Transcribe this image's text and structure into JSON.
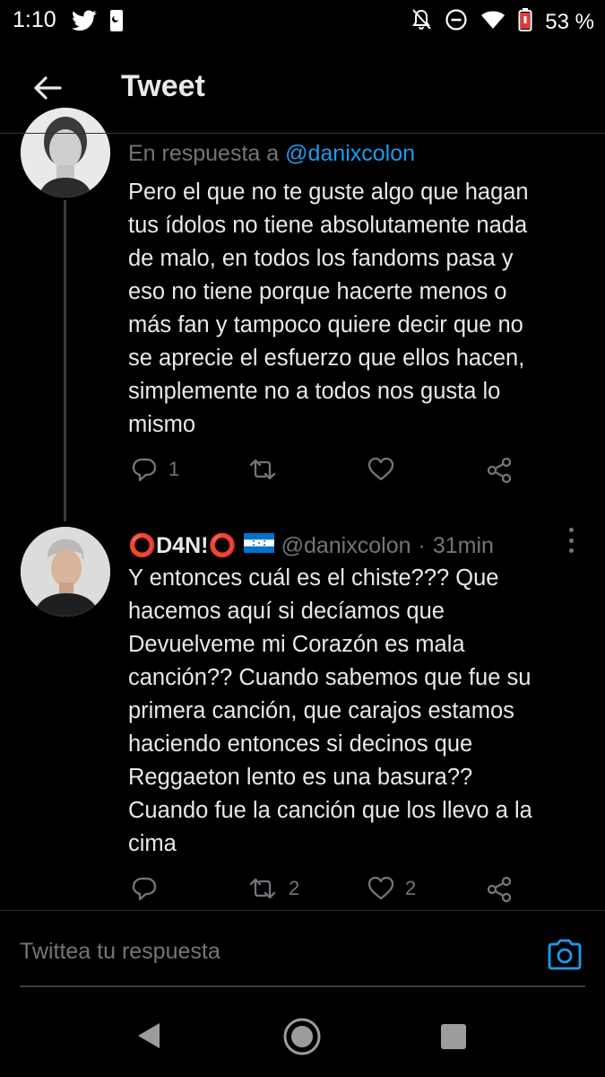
{
  "status_bar": {
    "time": "1:10",
    "battery": "53 %"
  },
  "header": {
    "title": "Tweet"
  },
  "tweet1": {
    "reply_prefix": "En respuesta a",
    "reply_handle": "@danixcolon",
    "text": "Pero el que no te guste algo que hagan\ntus ídolos no tiene absolutamente nada\nde malo, en todos los fandoms pasa y\neso no tiene porque hacerte menos o\nmás fan y tampoco quiere decir que no\nse aprecie el esfuerzo que ellos hacen,\nsimplemente no a todos nos gusta lo\nmismo",
    "reply_count": "1",
    "retweet_count": "",
    "like_count": ""
  },
  "tweet2": {
    "name": "⭕D4N!⭕",
    "handle": "@danixcolon",
    "separator": "·",
    "time": "31min",
    "text": "Y entonces cuál es el chiste??? Que\nhacemos aquí si decíamos que\nDevuelveme mi Corazón es mala\ncanción?? Cuando sabemos que fue su\nprimera canción, que carajos estamos\nhaciendo entonces si decinos que\nReggaeton lento es una basura??\nCuando fue la canción que los llevo a la\ncima",
    "reply_count": "",
    "retweet_count": "2",
    "like_count": "2"
  },
  "composer": {
    "placeholder": "Twittea tu respuesta"
  },
  "colors": {
    "background": "#000000",
    "text": "#e7e9ea",
    "secondary": "#71767b",
    "accent": "#1d9bf0",
    "flag_blue": "#0073cf"
  },
  "icons": {
    "back": "arrow-left-icon",
    "reply": "reply-icon",
    "retweet": "retweet-icon",
    "like": "heart-icon",
    "share": "share-icon",
    "more": "more-vertical-icon",
    "camera": "camera-icon",
    "flag": "honduras-flag-icon"
  }
}
